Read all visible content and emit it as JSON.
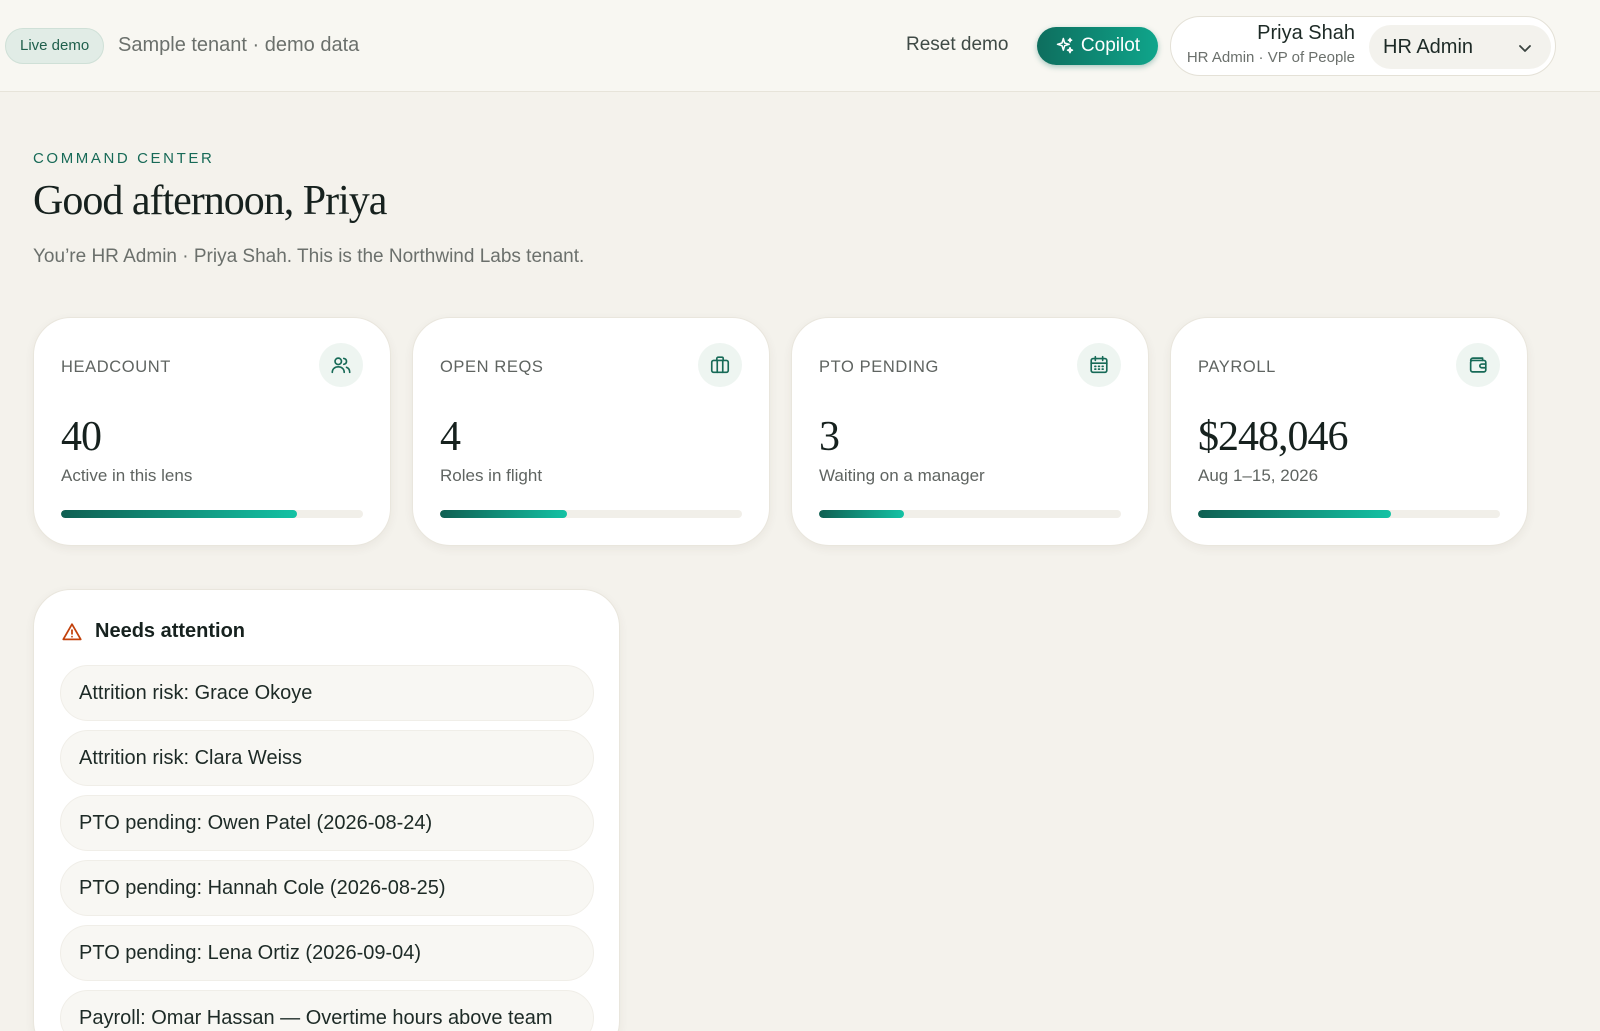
{
  "topbar": {
    "live_badge": "Live demo",
    "tenant": "Sample tenant · demo data",
    "reset_label": "Reset demo",
    "copilot_label": "Copilot",
    "user_name": "Priya Shah",
    "user_role": "HR Admin · VP of People",
    "role_select_value": "HR Admin"
  },
  "header": {
    "eyebrow": "COMMAND CENTER",
    "greeting": "Good afternoon, Priya",
    "subtitle": "You’re HR Admin · Priya Shah. This is the Northwind Labs tenant."
  },
  "kpis": [
    {
      "label": "HEADCOUNT",
      "icon": "users-icon",
      "value": "40",
      "sub": "Active in this lens",
      "progress": 0.78
    },
    {
      "label": "OPEN REQS",
      "icon": "briefcase-icon",
      "value": "4",
      "sub": "Roles in flight",
      "progress": 0.42
    },
    {
      "label": "PTO PENDING",
      "icon": "calendar-icon",
      "value": "3",
      "sub": "Waiting on a manager",
      "progress": 0.28
    },
    {
      "label": "PAYROLL",
      "icon": "wallet-icon",
      "value": "$248,046",
      "sub": "Aug 1–15, 2026",
      "progress": 0.64
    }
  ],
  "attention": {
    "title": "Needs attention",
    "icon": "warning-icon",
    "items": [
      "Attrition risk: Grace Okoye",
      "Attrition risk: Clara Weiss",
      "PTO pending: Owen Patel (2026-08-24)",
      "PTO pending: Hannah Cole (2026-08-25)",
      "PTO pending: Lena Ortiz (2026-09-04)",
      "Payroll: Omar Hassan — Overtime hours above team"
    ]
  },
  "colors": {
    "accent": "#0f6e5e",
    "accent_light": "#13c2a4",
    "warning": "#c2410c",
    "background": "#f4f2ec"
  }
}
